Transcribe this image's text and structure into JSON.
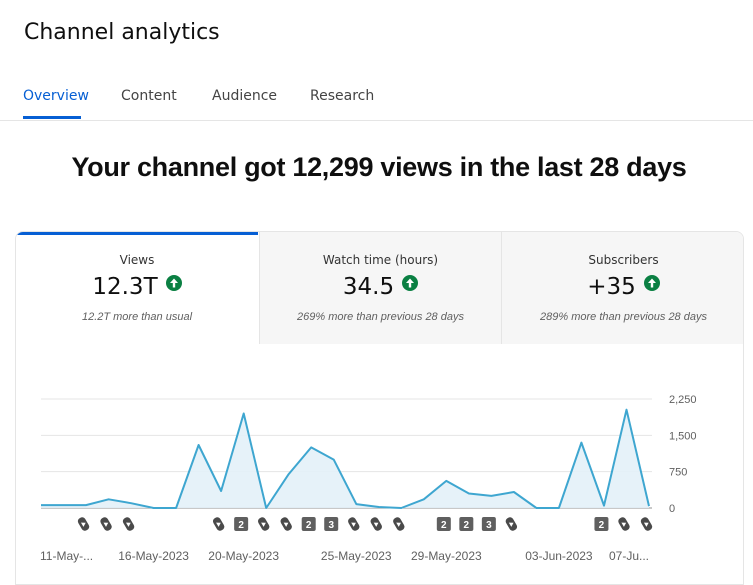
{
  "page": {
    "title": "Channel analytics"
  },
  "tabs": [
    {
      "label": "Overview",
      "active": true
    },
    {
      "label": "Content",
      "active": false
    },
    {
      "label": "Audience",
      "active": false
    },
    {
      "label": "Research",
      "active": false
    }
  ],
  "headline": "Your channel got 12,299 views in the last 28 days",
  "metrics": [
    {
      "label": "Views",
      "value": "12.3T",
      "trend_icon": "arrow-up-icon",
      "comparison": "12.2T more than usual",
      "selected": true
    },
    {
      "label": "Watch time (hours)",
      "value": "34.5",
      "trend_icon": "arrow-up-icon",
      "comparison": "269% more than previous 28 days",
      "selected": false
    },
    {
      "label": "Subscribers",
      "value": "+35",
      "trend_icon": "arrow-up-icon",
      "comparison": "289% more than previous 28 days",
      "selected": false
    }
  ],
  "colors": {
    "accent": "#065fd4",
    "trend_up": "#0b8043",
    "line": "#3ea6d0",
    "area_fill": "#e3f1f8"
  },
  "chart_data": {
    "type": "area",
    "y_axis": {
      "min": 0,
      "max": 2250,
      "ticks": [
        "0",
        "750",
        "1,500",
        "2,250"
      ],
      "position": "right"
    },
    "grid": true,
    "values": [
      60,
      60,
      60,
      180,
      100,
      0,
      0,
      1300,
      350,
      1950,
      0,
      700,
      1250,
      1000,
      80,
      20,
      0,
      180,
      560,
      300,
      250,
      330,
      0,
      0,
      1350,
      50,
      2030,
      40
    ],
    "x_tick_labels": [
      "11-May-...",
      "16-May-2023",
      "20-May-2023",
      "25-May-2023",
      "29-May-2023",
      "03-Jun-2023",
      "07-Ju..."
    ],
    "x_tick_days": [
      0,
      5,
      9,
      14,
      18,
      23,
      26
    ],
    "markers": [
      {
        "day": 1,
        "icon": "shorts-icon",
        "label": ""
      },
      {
        "day": 2,
        "icon": "shorts-icon",
        "label": ""
      },
      {
        "day": 3,
        "icon": "shorts-icon",
        "label": ""
      },
      {
        "day": 7,
        "icon": "shorts-icon",
        "label": ""
      },
      {
        "day": 8,
        "icon": "badge",
        "label": "2"
      },
      {
        "day": 9,
        "icon": "shorts-icon",
        "label": ""
      },
      {
        "day": 10,
        "icon": "shorts-icon",
        "label": ""
      },
      {
        "day": 11,
        "icon": "badge",
        "label": "2"
      },
      {
        "day": 12,
        "icon": "badge",
        "label": "3"
      },
      {
        "day": 13,
        "icon": "shorts-icon",
        "label": ""
      },
      {
        "day": 14,
        "icon": "shorts-icon",
        "label": ""
      },
      {
        "day": 15,
        "icon": "shorts-icon",
        "label": ""
      },
      {
        "day": 17,
        "icon": "badge",
        "label": "2"
      },
      {
        "day": 18,
        "icon": "badge",
        "label": "2"
      },
      {
        "day": 19,
        "icon": "badge",
        "label": "3"
      },
      {
        "day": 20,
        "icon": "shorts-icon",
        "label": ""
      },
      {
        "day": 24,
        "icon": "badge",
        "label": "2"
      },
      {
        "day": 25,
        "icon": "shorts-icon",
        "label": ""
      },
      {
        "day": 26,
        "icon": "shorts-icon",
        "label": ""
      }
    ]
  }
}
